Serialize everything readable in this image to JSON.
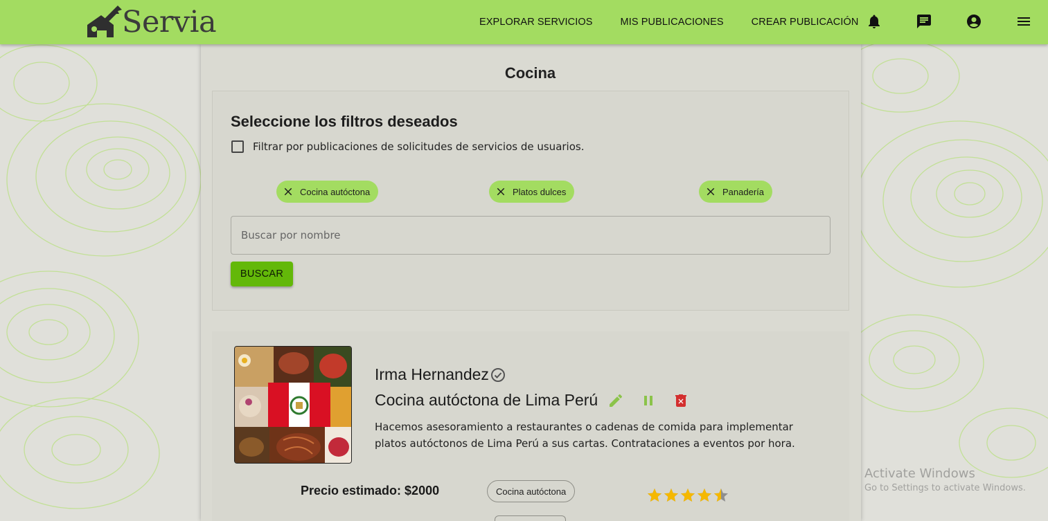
{
  "brand": {
    "name": "Servia"
  },
  "nav": {
    "links": [
      "EXPLORAR SERVICIOS",
      "MIS PUBLICACIONES",
      "CREAR PUBLICACIÓN"
    ],
    "icons": [
      "bell-icon",
      "chat-icon",
      "account-icon",
      "menu-icon"
    ]
  },
  "page": {
    "title": "Cocina"
  },
  "filters": {
    "heading": "Seleccione los filtros deseados",
    "checkbox_label": "Filtrar por publicaciones de solicitudes de servicios de usuarios.",
    "checkbox_checked": false,
    "chips": [
      "Cocina autóctona",
      "Platos dulces",
      "Panadería"
    ],
    "search_placeholder": "Buscar por nombre",
    "search_button": "BUSCAR"
  },
  "publication": {
    "author": "Irma Hernandez",
    "title": "Cocina autóctona de Lima Perú",
    "description": "Hacemos asesoramiento a restaurantes o cadenas de comida para implementar platos autóctonos de Lima Perú a sus cartas. Contrataciones a eventos por hora.",
    "price": "Precio estimado: $2000",
    "tag": "Cocina autóctona",
    "rating": 4.5,
    "rating_max": 5
  },
  "watermark": {
    "title": "Activate Windows",
    "subtitle": "Go to Settings to activate Windows."
  },
  "colors": {
    "navbar": "#a3dc61",
    "accent": "#63b809",
    "star": "#f5b800",
    "delete": "#d32f2f",
    "edit": "#8bc34a"
  }
}
